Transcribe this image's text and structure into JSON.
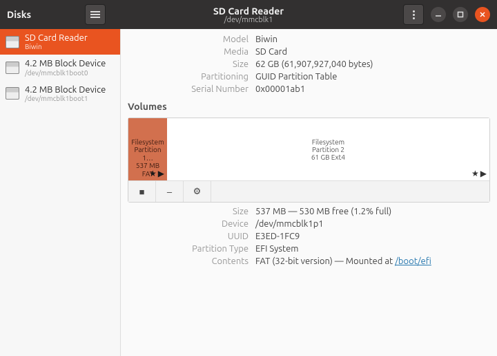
{
  "titlebar": {
    "app_name": "Disks",
    "device_title": "SD Card Reader",
    "device_path": "/dev/mmcblk1"
  },
  "sidebar": {
    "items": [
      {
        "title": "SD Card Reader",
        "subtitle": "Biwin",
        "selected": true
      },
      {
        "title": "4.2 MB Block Device",
        "subtitle": "/dev/mmcblk1boot0",
        "selected": false
      },
      {
        "title": "4.2 MB Block Device",
        "subtitle": "/dev/mmcblk1boot1",
        "selected": false
      }
    ]
  },
  "device_info": {
    "labels": {
      "model": "Model",
      "media": "Media",
      "size": "Size",
      "partitioning": "Partitioning",
      "serial": "Serial Number"
    },
    "model": "Biwin",
    "media": "SD Card",
    "size": "62 GB (61,907,927,040 bytes)",
    "partitioning": "GUID Partition Table",
    "serial": "0x00001ab1"
  },
  "volumes": {
    "heading": "Volumes",
    "items": [
      {
        "line1": "Filesystem",
        "line2": "Partition 1…",
        "line3": "537 MB FAT",
        "selected": true
      },
      {
        "line1": "Filesystem",
        "line2": "Partition 2",
        "line3": "61 GB Ext4",
        "selected": false
      }
    ]
  },
  "partition_info": {
    "labels": {
      "size": "Size",
      "device": "Device",
      "uuid": "UUID",
      "ptype": "Partition Type",
      "contents": "Contents"
    },
    "size": "537 MB — 530 MB free (1.2% full)",
    "device": "/dev/mmcblk1p1",
    "uuid": "E3ED-1FC9",
    "ptype": "EFI System",
    "contents_prefix": "FAT (32-bit version) — Mounted at ",
    "contents_link": "/boot/efi"
  },
  "icons": {
    "star": "★",
    "play": "▶",
    "stop": "■",
    "minus": "–",
    "gear": "⚙"
  }
}
